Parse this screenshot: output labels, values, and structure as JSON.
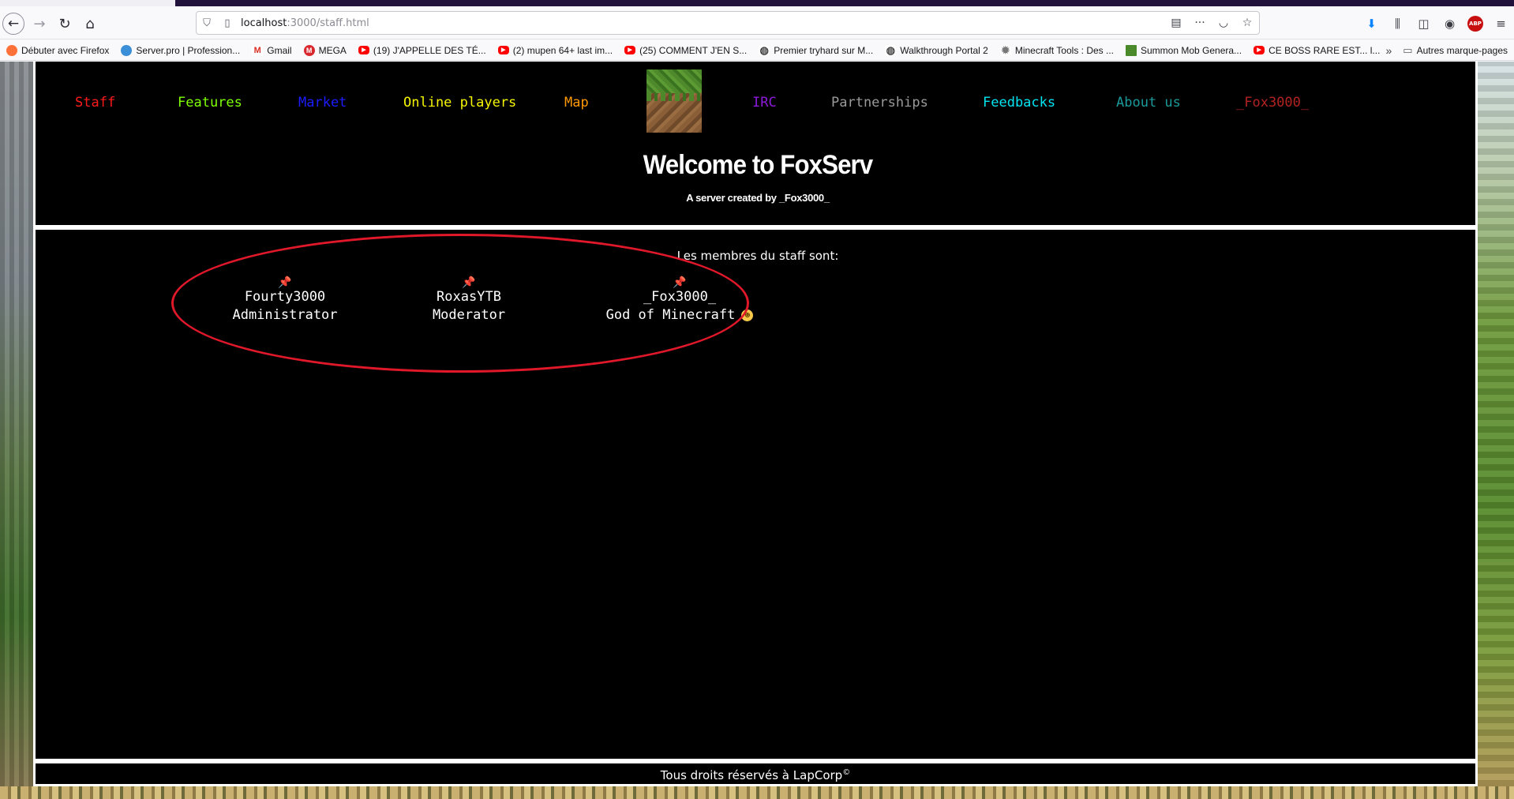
{
  "browser": {
    "url_host": "localhost",
    "url_path": ":3000/staff.html",
    "bookmarks": [
      {
        "label": "Débuter avec Firefox",
        "icon": "firefox-icon"
      },
      {
        "label": "Server.pro | Profession...",
        "icon": "serverpro-icon"
      },
      {
        "label": "Gmail",
        "icon": "gmail-icon"
      },
      {
        "label": "MEGA",
        "icon": "mega-icon"
      },
      {
        "label": "(19) J'APPELLE DES TÉ...",
        "icon": "youtube-icon"
      },
      {
        "label": "(2) mupen 64+ last im...",
        "icon": "youtube-icon"
      },
      {
        "label": "(25) COMMENT J'EN S...",
        "icon": "youtube-icon"
      },
      {
        "label": "Premier tryhard sur M...",
        "icon": "globe-icon"
      },
      {
        "label": "Walkthrough Portal 2",
        "icon": "globe-icon"
      },
      {
        "label": "Minecraft Tools : Des ...",
        "icon": "gear-icon"
      },
      {
        "label": "Summon Mob Genera...",
        "icon": "minecraft-icon"
      },
      {
        "label": "CE BOSS RARE EST... l...",
        "icon": "youtube-icon"
      }
    ],
    "other_bookmarks": "Autres marque-pages"
  },
  "nav": [
    {
      "label": "Staff",
      "color": "#ff1a1a"
    },
    {
      "label": "Features",
      "color": "#7fff00"
    },
    {
      "label": "Market",
      "color": "#1c1cff"
    },
    {
      "label": "Online players",
      "color": "#f5f500"
    },
    {
      "label": "Map",
      "color": "#ff9900"
    },
    {
      "label": "IRC",
      "color": "#8b1ad9"
    },
    {
      "label": "Partnerships",
      "color": "#9a9a9a"
    },
    {
      "label": "Feedbacks",
      "color": "#00e5f0"
    },
    {
      "label": "About us",
      "color": "#1a9a9a"
    },
    {
      "label": "_Fox3000_",
      "color": "#b22222"
    }
  ],
  "header": {
    "title": "Welcome to FoxServ",
    "subtitle": "A server created by _Fox3000_"
  },
  "staff": {
    "intro": "Les membres du staff sont:",
    "members": [
      {
        "name": "Fourty3000",
        "role": "Administrator"
      },
      {
        "name": "RoxasYTB",
        "role": "Moderator"
      },
      {
        "name": "_Fox3000_",
        "role": "God of Minecraft"
      }
    ]
  },
  "footer": {
    "text": "Tous droits réservés à LapCorp",
    "symbol": "©"
  },
  "colors": {
    "annotation": "#e0182a",
    "page_bg": "#000000",
    "border": "#ffffff"
  }
}
